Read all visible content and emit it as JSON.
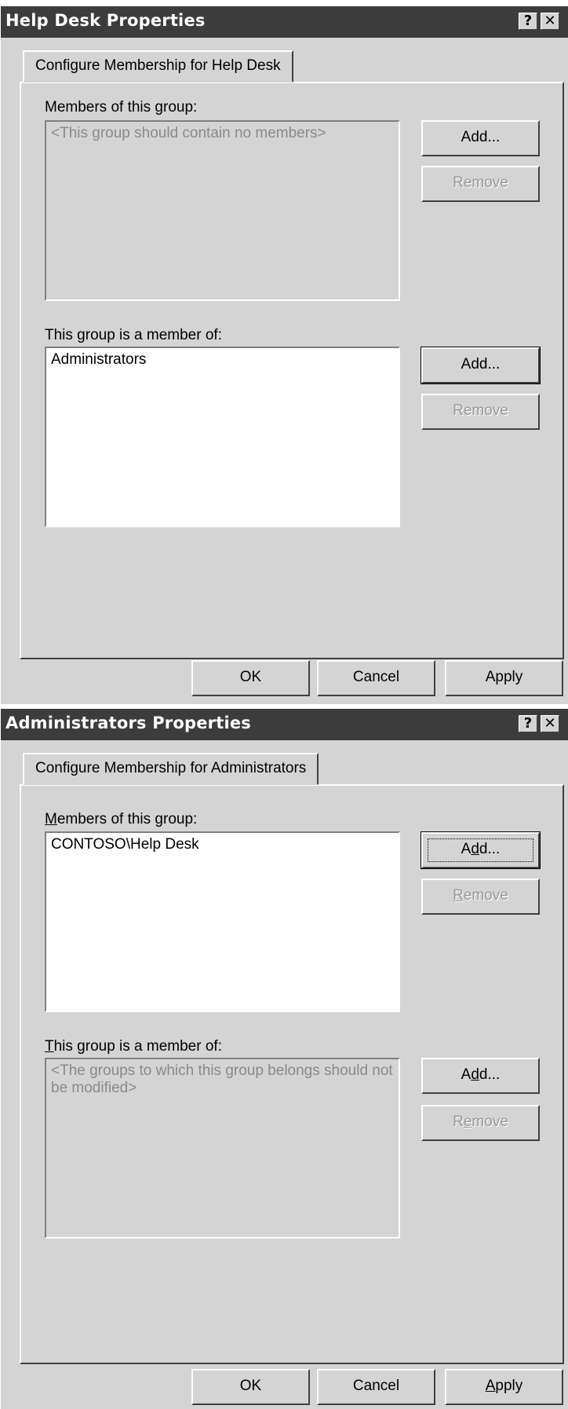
{
  "dialogs": [
    {
      "title": "Help Desk Properties",
      "help_glyph": "?",
      "close_glyph": "✕",
      "tab_label": "Configure Membership for Help Desk",
      "members_label": "Members of this group:",
      "members_placeholder": "<This group should contain no members>",
      "members": [],
      "members_add": "Add...",
      "members_remove": "Remove",
      "memberof_label": "This group is a member of:",
      "memberof": [
        "Administrators"
      ],
      "memberof_add": "Add...",
      "memberof_remove": "Remove",
      "ok": "OK",
      "cancel": "Cancel",
      "apply": "Apply"
    },
    {
      "title": "Administrators Properties",
      "help_glyph": "?",
      "close_glyph": "✕",
      "tab_label": "Configure Membership for Administrators",
      "members_label_first": "M",
      "members_label_rest": "embers of this group:",
      "members": [
        "CONTOSO\\Help Desk"
      ],
      "members_add_pre": "A",
      "members_add_key": "d",
      "members_add_post": "d...",
      "members_remove_key": "R",
      "members_remove_rest": "emove",
      "memberof_label_first": "T",
      "memberof_label_rest": "his group is a member of:",
      "memberof_placeholder": "<The groups to which this group belongs should not be modified>",
      "memberof_add_pre": "A",
      "memberof_add_key": "d",
      "memberof_add_post": "d...",
      "memberof_remove_pre": "R",
      "memberof_remove_key": "e",
      "memberof_remove_post": "move",
      "ok": "OK",
      "cancel": "Cancel",
      "apply_key": "A",
      "apply_rest": "pply"
    }
  ]
}
